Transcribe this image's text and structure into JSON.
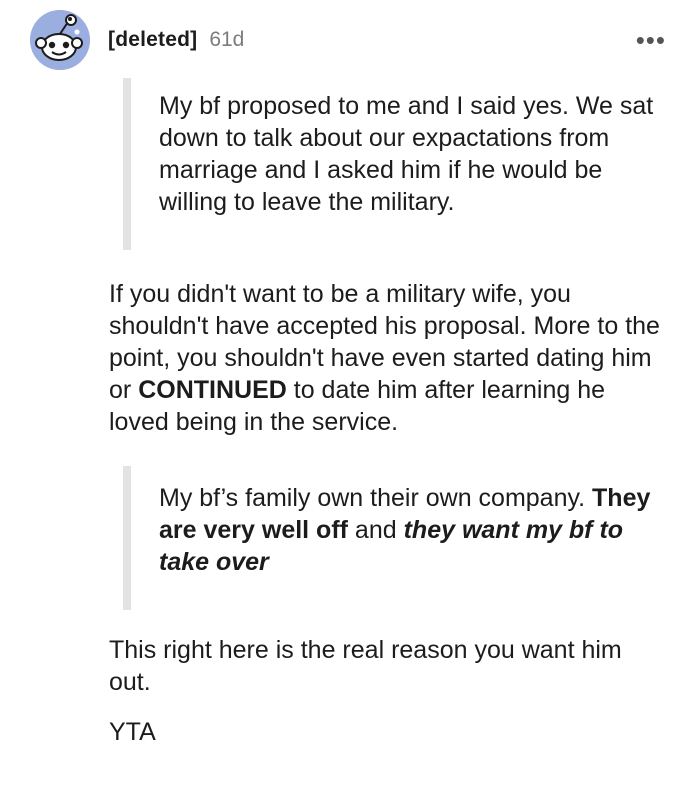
{
  "comment": {
    "username": "[deleted]",
    "age": "61d",
    "more_menu": "•••",
    "avatar_icon": "snoo-avatar-icon",
    "quote1": "My bf proposed to me and I said yes. We sat down to talk about our expactations from marriage and I asked him if he would be willing to leave the military.",
    "para1_part1": "If you didn't want to be a military wife, you shouldn't have accepted his proposal. More to the point, you shouldn't have even started dating him or ",
    "para1_bold": "CONTINUED",
    "para1_part2": " to date him after learning he loved being in the service.",
    "quote2_part1": "My bf’s family own their own company. ",
    "quote2_bold": "They are very well off",
    "quote2_mid": " and ",
    "quote2_bolditalic": "they want my bf to take over",
    "para2": "This right here is the real reason you want him out.",
    "para3": "YTA"
  },
  "colors": {
    "avatar_bg": "#9aaee0",
    "quote_bar": "#e3e3e3",
    "text": "#1c1c1c",
    "muted": "#7c7c7c"
  }
}
